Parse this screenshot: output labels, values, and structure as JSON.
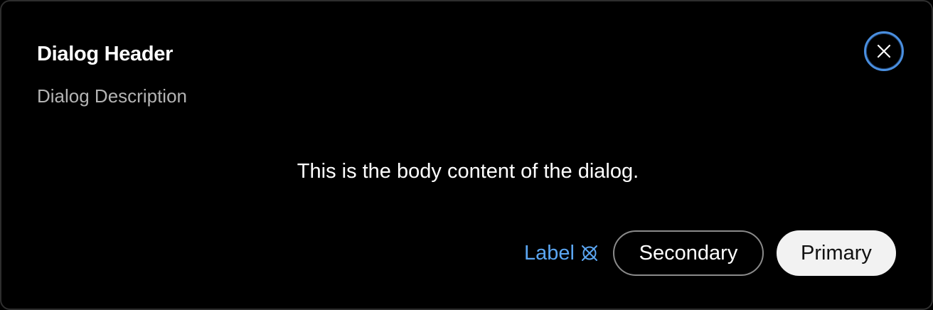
{
  "dialog": {
    "header": "Dialog Header",
    "description": "Dialog Description",
    "body": "This is the body content of the dialog.",
    "close_icon": "close-icon"
  },
  "footer": {
    "link_label": "Label",
    "link_icon": "close-circle-outline-icon",
    "secondary_label": "Secondary",
    "primary_label": "Primary"
  },
  "colors": {
    "background": "#000000",
    "accent": "#5ba6f2",
    "focus_ring": "#4a8fe0",
    "primary_button_bg": "#f2f2f2",
    "secondary_button_border": "#8a8a8a",
    "description_text": "#b3b3b3"
  }
}
